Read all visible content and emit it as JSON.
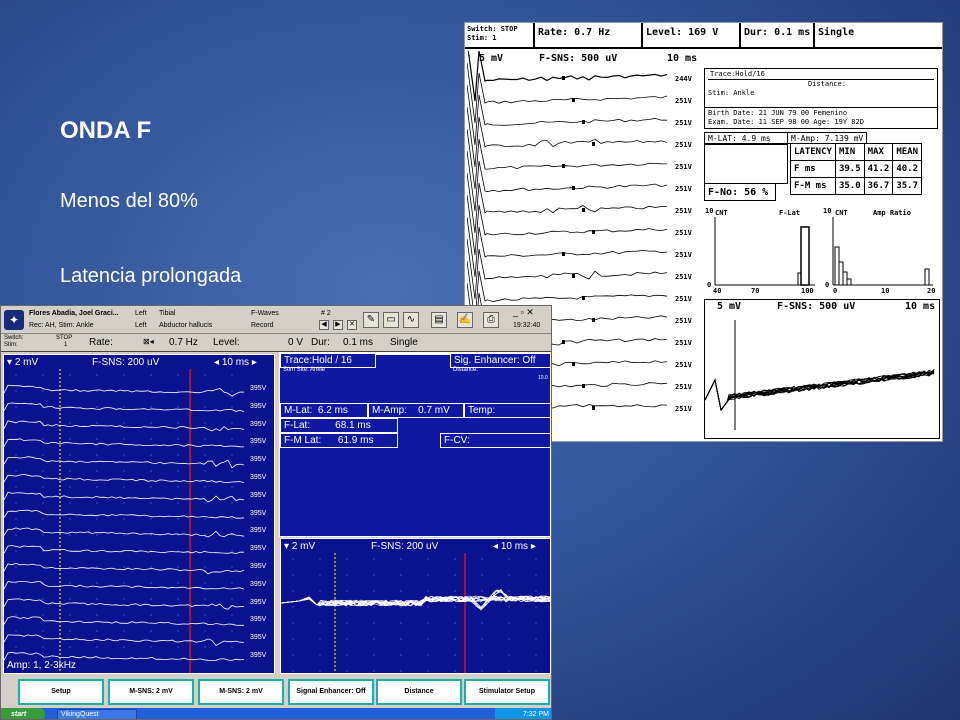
{
  "slide": {
    "title": "ONDA F",
    "bullets": [
      "Menos del 80%",
      "Latencia prolongada"
    ]
  },
  "printout": {
    "switch": "Switch: STOP",
    "stim": "Stim: 1",
    "rate": "Rate:      0.7 Hz",
    "level": "Level:    169 V",
    "dur": "Dur: 0.1 ms",
    "mode": "Single",
    "trace": "Trace:Hold/16",
    "distance": "Distance:",
    "stim_site": "Stim: Ankle",
    "birth": "Birth Date: 21 JUN 79 00   Femenino",
    "exam": "Exam. Date: 11 SEP 98 00   Age: 19Y 82D",
    "mlat": "M-LAT:   4.9 ms",
    "mamp": "M-Amp: 7.139 mV",
    "trace_sens": "5 mV",
    "trace_fsns": "F-SNS: 500 uV",
    "trace_time": "10 ms",
    "trace_levels": [
      "244V",
      "251V",
      "251V",
      "251V",
      "251V",
      "251V",
      "251V",
      "251V",
      "251V",
      "251V",
      "251V",
      "251V",
      "251V",
      "251V",
      "251V",
      "251V"
    ],
    "table_headers": [
      "LATENCY",
      "MIN",
      "MAX",
      "MEAN"
    ],
    "table_rows": [
      [
        "F      ms",
        "39.5",
        "41.2",
        "40.2"
      ],
      [
        "F-M    ms",
        "35.0",
        "36.7",
        "35.7"
      ]
    ],
    "f_no": "F-No:  56 %",
    "hist1_title": "F-Lat",
    "hist1_cnt": "CNT",
    "hist1_ymax": "10",
    "hist1_ymin": "0",
    "hist1_x": [
      "40",
      "70",
      "100"
    ],
    "hist2_title": "Amp Ratio",
    "hist2_cnt": "CNT",
    "hist2_ymax": "10",
    "hist2_ymin": "0",
    "hist2_x": [
      "0",
      "10",
      "20"
    ],
    "sup_sens": "5 mV",
    "sup_fsns": "F-SNS: 500 uV",
    "sup_time": "10 ms"
  },
  "viking": {
    "patient_name": "Flores Abadia, Joel Graci...",
    "rec": "Rec: AH, Stim: Ankle",
    "side1": "Left",
    "side2": "Left",
    "nerve": "Tibial",
    "muscle": "Abductor hallucis",
    "test": "F-Waves",
    "mode": "Record",
    "trace_num": "# 2",
    "time": "19:32:40",
    "switch_label": "Switch:",
    "switch_value": "STOP",
    "stim_label": "Stim:",
    "stim_value": "1",
    "rate_label": "Rate:",
    "rate_value": "0.7 Hz",
    "level_label": "Level:",
    "level_value": "0 V",
    "dur_label": "Dur:",
    "dur_value": "0.1 ms",
    "stim_mode": "Single",
    "left_sens": "2 mV",
    "left_fsns": "F-SNS: 200 uV",
    "left_time": "10 ms",
    "amp": "Amp: 1, 2-3kHz",
    "trace_levels": [
      "395V",
      "395V",
      "395V",
      "395V",
      "395V",
      "395V",
      "395V",
      "395V",
      "395V",
      "395V",
      "395V",
      "395V",
      "395V",
      "395V",
      "395V",
      "395V"
    ],
    "trace_hold": "Trace:Hold / 16",
    "sig_enhancer": "Sig. Enhancer: Off",
    "stim_site": "Stim Site:  Ankle",
    "distance": "Distance:",
    "scale_label": "10.0",
    "m_lat_label": "M-Lat:",
    "m_lat": "6.2 ms",
    "m_amp_label": "M-Amp:",
    "m_amp": "0.7 mV",
    "temp": "Temp:",
    "f_lat_label": "F-Lat:",
    "f_lat": "68.1 ms",
    "fm_lat_label": "F-M Lat:",
    "fm_lat": "61.9 ms",
    "f_cv": "F-CV:",
    "right_sens": "2 mV",
    "right_fsns": "F-SNS: 200 uV",
    "right_time": "10 ms",
    "buttons": [
      "Setup",
      "M-SNS:   2 mV",
      "M-SNS:   2 mV",
      "Signal Enhancer: Off",
      "Distance",
      "Stimulator Setup"
    ],
    "start": "start",
    "task": "VikingQuest",
    "clock": "7:32 PM"
  },
  "colors": {
    "slide_bg": "#33559a",
    "panel_bg": "#0a1290",
    "cursor_yellow": "#f0e000",
    "cursor_red": "#e01010"
  }
}
